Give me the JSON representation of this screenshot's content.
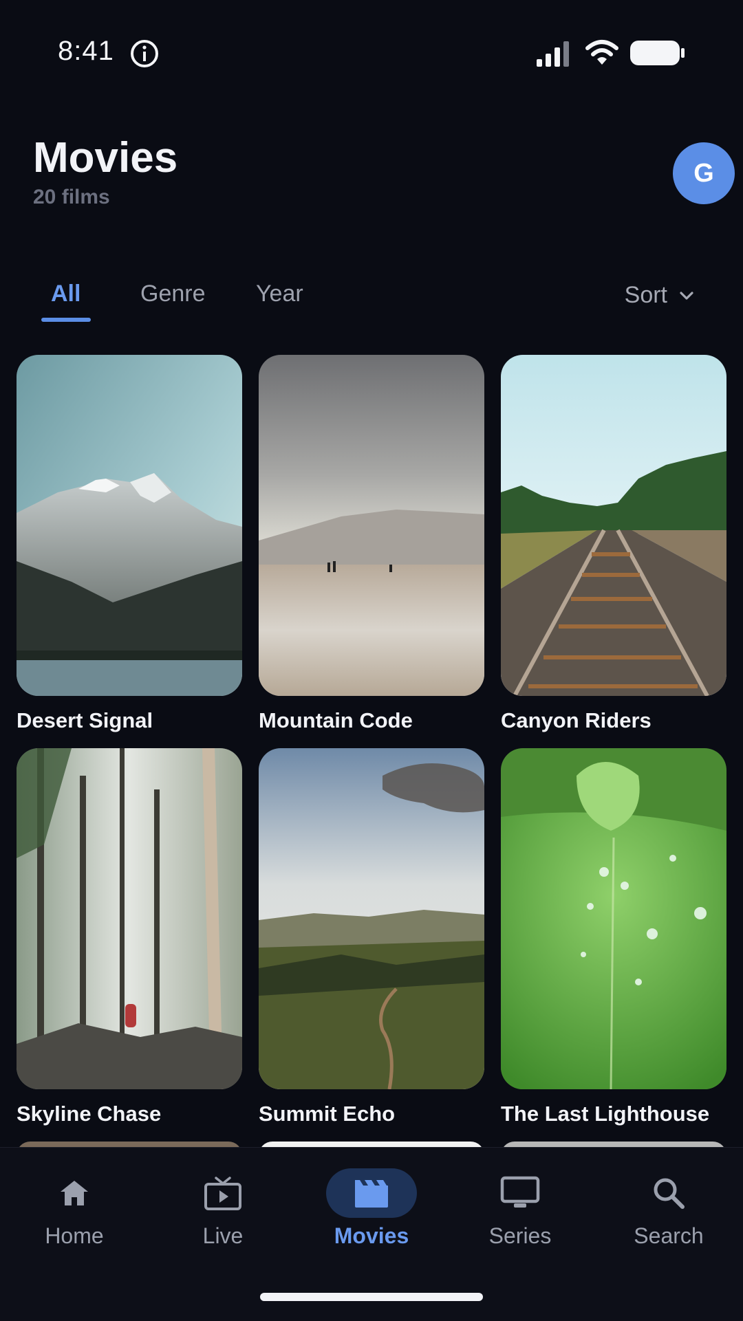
{
  "status_bar": {
    "time": "8:41"
  },
  "header": {
    "title": "Movies",
    "count": "20 films",
    "avatar_initial": "G"
  },
  "tabs": [
    {
      "label": "All",
      "active": true
    },
    {
      "label": "Genre",
      "active": false
    },
    {
      "label": "Year",
      "active": false
    }
  ],
  "sort": {
    "label": "Sort"
  },
  "movies": [
    {
      "title": "Desert Signal",
      "poster": "snowy-mountain-lake"
    },
    {
      "title": "Mountain Code",
      "poster": "misty-beach-hills"
    },
    {
      "title": "Canyon Riders",
      "poster": "railway-tracks-forest"
    },
    {
      "title": "Skyline Chase",
      "poster": "foggy-forest-hiker"
    },
    {
      "title": "Summit Echo",
      "poster": "valley-dirt-road"
    },
    {
      "title": "The Last Lighthouse",
      "poster": "leaf-water-drops"
    }
  ],
  "bottom_nav": [
    {
      "label": "Home",
      "icon": "home-icon",
      "active": false
    },
    {
      "label": "Live",
      "icon": "tv-play-icon",
      "active": false
    },
    {
      "label": "Movies",
      "icon": "clapperboard-icon",
      "active": true
    },
    {
      "label": "Series",
      "icon": "monitor-icon",
      "active": false
    },
    {
      "label": "Search",
      "icon": "search-icon",
      "active": false
    }
  ],
  "colors": {
    "background": "#0a0c14",
    "accent": "#5b8ee6",
    "nav_active_bg": "#1e3358"
  }
}
